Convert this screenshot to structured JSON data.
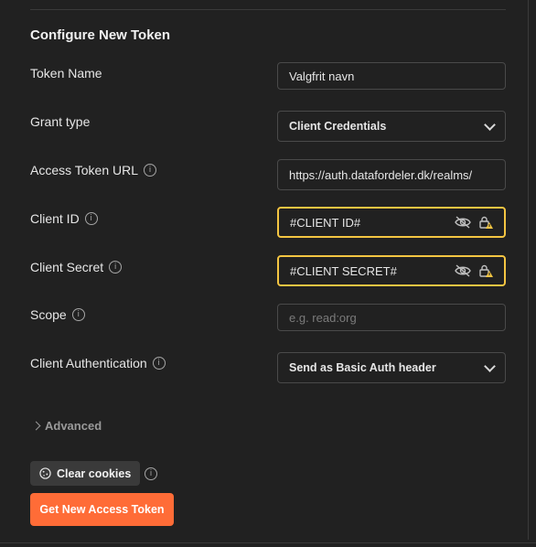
{
  "title": "Configure New Token",
  "fields": {
    "token_name": {
      "label": "Token Name",
      "value": "Valgfrit navn"
    },
    "grant_type": {
      "label": "Grant type",
      "value": "Client Credentials"
    },
    "access_token_url": {
      "label": "Access Token URL",
      "value": "https://auth.datafordeler.dk/realms/"
    },
    "client_id": {
      "label": "Client ID",
      "value": "#CLIENT ID#"
    },
    "client_secret": {
      "label": "Client Secret",
      "value": "#CLIENT SECRET#"
    },
    "scope": {
      "label": "Scope",
      "placeholder": "e.g. read:org"
    },
    "client_auth": {
      "label": "Client Authentication",
      "value": "Send as Basic Auth header"
    }
  },
  "advanced_label": "Advanced",
  "clear_cookies_label": "Clear cookies",
  "get_token_label": "Get New Access Token",
  "colors": {
    "accent": "#ff6c37",
    "warning_border": "#f4c542",
    "background": "#212121"
  }
}
